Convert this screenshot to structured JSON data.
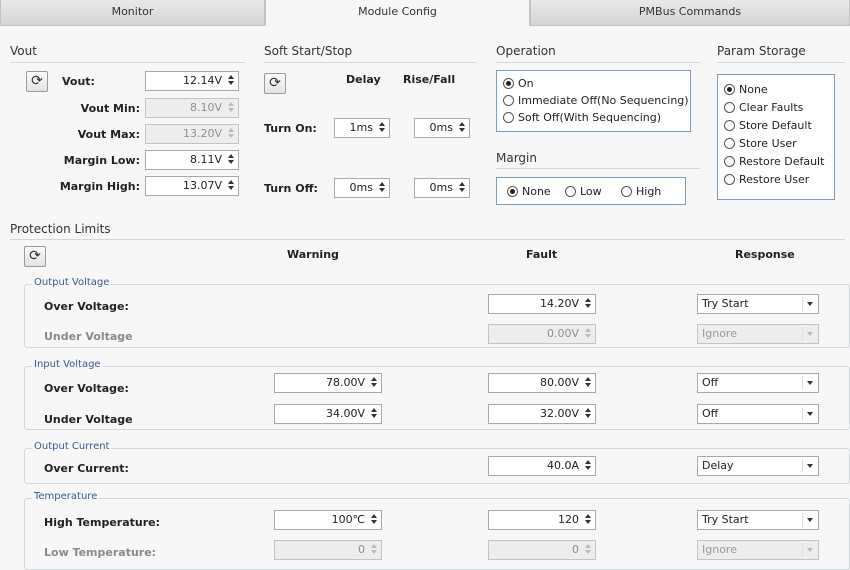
{
  "tabs": [
    {
      "label": "Monitor"
    },
    {
      "label": "Module Config"
    },
    {
      "label": "PMBus Commands"
    }
  ],
  "vout": {
    "title": "Vout",
    "rows": [
      {
        "label": "Vout:",
        "value": "12.14V",
        "disabled": false
      },
      {
        "label": "Vout Min:",
        "value": "8.10V",
        "disabled": true
      },
      {
        "label": "Vout Max:",
        "value": "13.20V",
        "disabled": true
      },
      {
        "label": "Margin Low:",
        "value": "8.11V",
        "disabled": false
      },
      {
        "label": "Margin High:",
        "value": "13.07V",
        "disabled": false
      }
    ]
  },
  "soft": {
    "title": "Soft Start/Stop",
    "delay_header": "Delay",
    "rise_header": "Rise/Fall",
    "turn_on": {
      "label": "Turn On:",
      "delay": "1ms",
      "rise": "0ms"
    },
    "turn_off": {
      "label": "Turn Off:",
      "delay": "0ms",
      "rise": "0ms"
    }
  },
  "operation": {
    "title": "Operation",
    "options": [
      {
        "label": "On",
        "selected": true
      },
      {
        "label": "Immediate Off(No Sequencing)",
        "selected": false
      },
      {
        "label": "Soft Off(With Sequencing)",
        "selected": false
      }
    ]
  },
  "margin": {
    "title": "Margin",
    "options": [
      {
        "label": "None",
        "selected": true
      },
      {
        "label": "Low",
        "selected": false
      },
      {
        "label": "High",
        "selected": false
      }
    ]
  },
  "param": {
    "title": "Param Storage",
    "options": [
      {
        "label": "None",
        "selected": true
      },
      {
        "label": "Clear Faults",
        "selected": false
      },
      {
        "label": "Store Default",
        "selected": false
      },
      {
        "label": "Store User",
        "selected": false
      },
      {
        "label": "Restore Default",
        "selected": false
      },
      {
        "label": "Restore User",
        "selected": false
      }
    ]
  },
  "protection": {
    "title": "Protection Limits",
    "columns": {
      "warning": "Warning",
      "fault": "Fault",
      "response": "Response"
    },
    "groups": [
      {
        "label": "Output Voltage",
        "rows": [
          {
            "label": "Over Voltage:",
            "warning": null,
            "fault": "14.20V",
            "response": "Try Start",
            "disabled": false
          },
          {
            "label": "Under Voltage",
            "warning": null,
            "fault": "0.00V",
            "response": "Ignore",
            "disabled": true
          }
        ]
      },
      {
        "label": "Input Voltage",
        "rows": [
          {
            "label": "Over Voltage:",
            "warning": "78.00V",
            "fault": "80.00V",
            "response": "Off",
            "disabled": false
          },
          {
            "label": "Under Voltage",
            "warning": "34.00V",
            "fault": "32.00V",
            "response": "Off",
            "disabled": false
          }
        ]
      },
      {
        "label": "Output Current",
        "rows": [
          {
            "label": "Over Current:",
            "warning": null,
            "fault": "40.0A",
            "response": "Delay",
            "disabled": false
          }
        ]
      },
      {
        "label": "Temperature",
        "rows": [
          {
            "label": "High Temperature:",
            "warning": "100℃",
            "fault": "120",
            "response": "Try Start",
            "disabled": false
          },
          {
            "label": "Low Temperature:",
            "warning": "0",
            "fault": "0",
            "response": "Ignore",
            "disabled": true
          }
        ]
      }
    ]
  },
  "icons": {
    "refresh": "refresh-icon"
  }
}
